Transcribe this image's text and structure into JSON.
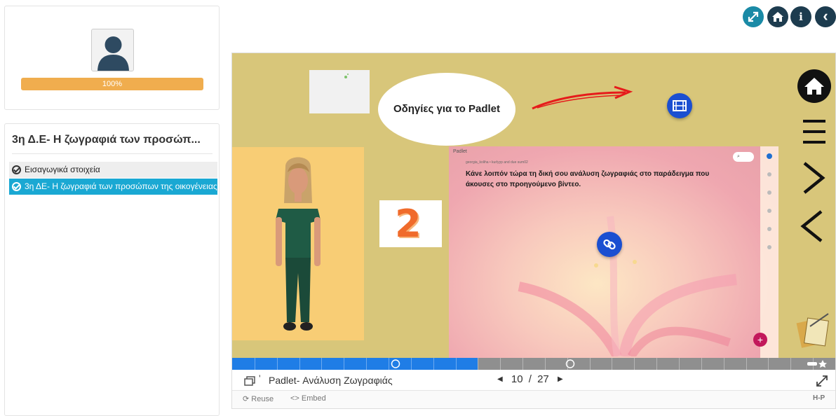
{
  "profile": {
    "progress_label": "100%",
    "progress_value": 100
  },
  "course": {
    "title": "3η Δ.Ε- Η ζωγραφιά των προσώπ...",
    "lessons": [
      {
        "label": "Εισαγωγικά στοιχεία",
        "active": false
      },
      {
        "label": "3η ΔΕ- Η ζωγραφιά των προσώπων της οικογένειας",
        "active": true
      }
    ]
  },
  "top_buttons": [
    "expand-icon",
    "home-icon",
    "info-icon",
    "back-icon"
  ],
  "top_button_glyphs": {
    "info": "i",
    "back": "‹"
  },
  "stage": {
    "bubble_text": "Οδηγίες για το Padlet",
    "number_card": "2",
    "padlet": {
      "label": "Padlet",
      "subtitle": "georgia_koliha • kurlyyp and due sum02",
      "text": "Κάνε λοιπόν τώρα τη δική σου ανάλυση ζωγραφιάς στο παράδειγμα που άκουσες στο προηγούμενο βίντεο."
    }
  },
  "colors": {
    "accent_blue": "#1f7de6",
    "progress_orange": "#f0ad4e",
    "stage_bg": "#d8c67a",
    "active_lesson": "#1aa8d3"
  },
  "slides": {
    "current": 10,
    "total": 27,
    "separator": "/"
  },
  "footer": {
    "slide_title": "Padlet- Ανάλυση Ζωγραφιάς",
    "reuse_label": "Reuse",
    "embed_label": "Embed",
    "h5p_label": "H-P"
  }
}
